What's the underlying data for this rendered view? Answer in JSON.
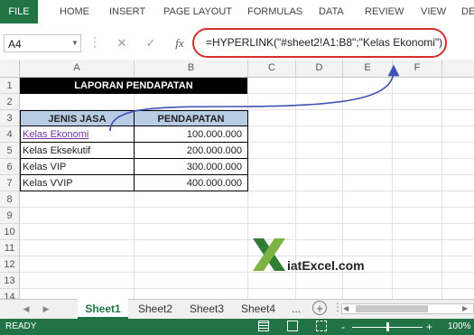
{
  "ribbon": {
    "file": "FILE",
    "tabs": [
      "HOME",
      "INSERT",
      "PAGE LAYOUT",
      "FORMULAS",
      "DATA",
      "REVIEW",
      "VIEW",
      "DE"
    ]
  },
  "formula_bar": {
    "name_box": "A4",
    "fx": "fx",
    "formula": "=HYPERLINK(\"#sheet2!A1:B8\";\"Kelas Ekonomi\")"
  },
  "columns": [
    "A",
    "B",
    "C",
    "D",
    "E",
    "F"
  ],
  "rows": [
    "1",
    "2",
    "3",
    "4",
    "5",
    "6",
    "7",
    "8",
    "9",
    "10",
    "11",
    "12",
    "13",
    "14"
  ],
  "sheet": {
    "title": "LAPORAN PENDAPATAN",
    "headers": [
      "JENIS JASA",
      "PENDAPATAN"
    ],
    "data": [
      [
        "Kelas Ekonomi",
        "100.000.000"
      ],
      [
        "Kelas Eksekutif",
        "200.000.000"
      ],
      [
        "Kelas VIP",
        "300.000.000"
      ],
      [
        "Kelas VVIP",
        "400.000.000"
      ]
    ]
  },
  "watermark": "iatExcel.com",
  "sheet_tabs": [
    "Sheet1",
    "Sheet2",
    "Sheet3",
    "Sheet4",
    "..."
  ],
  "status": {
    "ready": "READY",
    "zoom": "100%",
    "zoom_minus": "-",
    "zoom_plus": "+"
  },
  "colors": {
    "excel_green": "#217346",
    "header_fill": "#b8cce4",
    "hyperlink": "#7030a0",
    "annotation_red": "#d32f2f",
    "arrow_blue": "#3f51b5"
  }
}
